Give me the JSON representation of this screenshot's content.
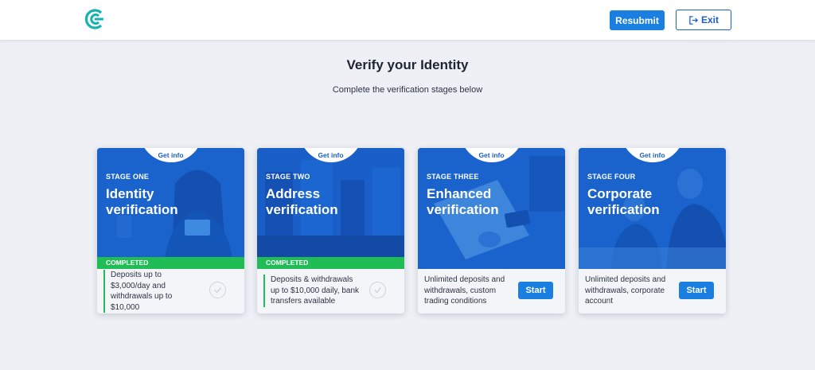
{
  "header": {
    "logo_icon": "cex-logo-icon",
    "resubmit_label": "Resubmit",
    "exit_label": "Exit",
    "exit_icon": "sign-out-icon",
    "brand_color": "#1a7fe0"
  },
  "page": {
    "title": "Verify your Identity",
    "subtitle": "Complete the verification stages below"
  },
  "stages": [
    {
      "info_link": "Get info",
      "stage": "STAGE ONE",
      "line1": "Identity",
      "line2": "verification",
      "status": "COMPLETED",
      "description": "Deposits up to $3,000/day and withdrawals up to $10,000",
      "action_icon": "check-circle-icon"
    },
    {
      "info_link": "Get info",
      "stage": "STAGE TWO",
      "line1": "Address",
      "line2": "verification",
      "status": "COMPLETED",
      "description": "Deposits & withdrawals up to $10,000 daily, bank transfers available",
      "action_icon": "check-circle-icon"
    },
    {
      "info_link": "Get info",
      "stage": "STAGE THREE",
      "line1": "Enhanced",
      "line2": "verification",
      "description": "Unlimited deposits and withdrawals, custom trading conditions",
      "action_label": "Start"
    },
    {
      "info_link": "Get info",
      "stage": "STAGE FOUR",
      "line1": "Corporate",
      "line2": "verification",
      "description": "Unlimited deposits and withdrawals, corporate account",
      "action_label": "Start"
    }
  ],
  "colors": {
    "card_blue": "#1760c9",
    "completed_green": "#20bd57",
    "logo_teal": "#14b3b0"
  }
}
